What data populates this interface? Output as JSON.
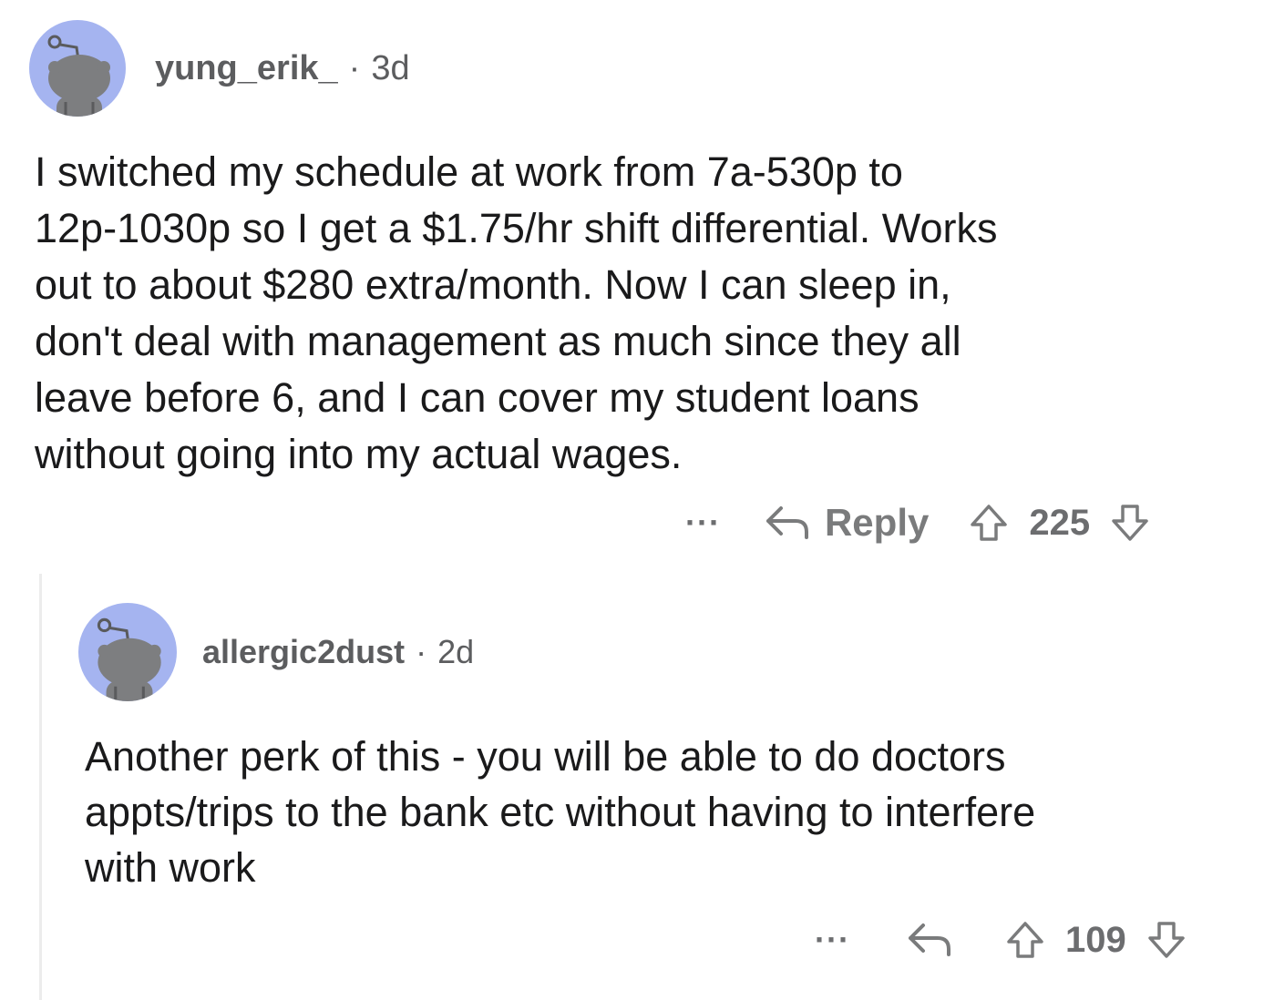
{
  "comments": [
    {
      "username": "yung_erik_",
      "separator": "·",
      "age": "3d",
      "body": "I switched my schedule at work from 7a-530p to\n12p-1030p so I get a $1.75/hr shift differential. Works\nout to about $280 extra/month. Now I can sleep in,\ndon't deal with management as much since they all\nleave before 6, and I can cover my student loans\nwithout going into my actual wages.",
      "more": "···",
      "reply_label": "Reply",
      "votes": "225",
      "icons": [
        "avatar-icon",
        "more-icon",
        "reply-icon",
        "upvote-icon",
        "downvote-icon"
      ]
    },
    {
      "username": "allergic2dust",
      "separator": "·",
      "age": "2d",
      "body": "Another perk of this - you will be able to do doctors\nappts/trips to the bank etc without having to interfere\nwith work",
      "more": "···",
      "votes": "109",
      "icons": [
        "avatar-icon",
        "more-icon",
        "reply-icon",
        "upvote-icon",
        "downvote-icon"
      ]
    }
  ],
  "colors": {
    "avatar_bg": "#a5b4f0",
    "snoo": "#7d7e80",
    "text": "#1a1a1b",
    "muted": "#7a7b7c",
    "thread_line": "#ececec"
  }
}
